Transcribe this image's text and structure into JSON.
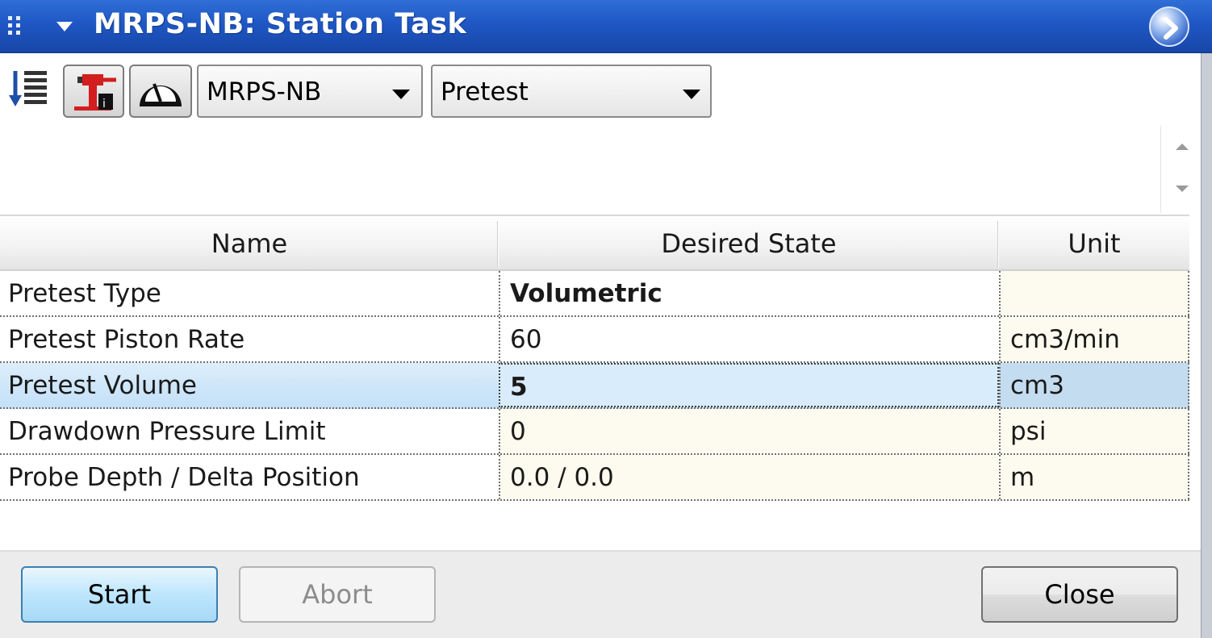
{
  "window": {
    "title": "MRPS-NB: Station Task",
    "icons": [
      "grip-icon",
      "collapse-arrow-icon",
      "expand-circle-icon"
    ]
  },
  "toolbar": {
    "station_select": "MRPS-NB",
    "mode_select": "Pretest",
    "icons": [
      "sort-list-icon",
      "valve-icon",
      "gauge-icon"
    ]
  },
  "table": {
    "headers": {
      "name": "Name",
      "state": "Desired State",
      "unit": "Unit"
    },
    "rows": [
      {
        "name": "Pretest Type",
        "state": "Volumetric",
        "unit": ""
      },
      {
        "name": "Pretest Piston Rate",
        "state": "60",
        "unit": "cm3/min"
      },
      {
        "name": "Pretest Volume",
        "state": "5",
        "unit": "cm3"
      },
      {
        "name": "Drawdown Pressure Limit",
        "state": "0",
        "unit": "psi"
      },
      {
        "name": "Probe Depth / Delta Position",
        "state": "0.0 / 0.0",
        "unit": "m"
      }
    ]
  },
  "footer": {
    "start_label": "Start",
    "abort_label": "Abort",
    "close_label": "Close"
  },
  "colors": {
    "titlebar": "#1f57c4",
    "selected_row": "#cfe6fb",
    "readonly_cell": "#fdfbef",
    "editable_cell": "#ffffff"
  }
}
